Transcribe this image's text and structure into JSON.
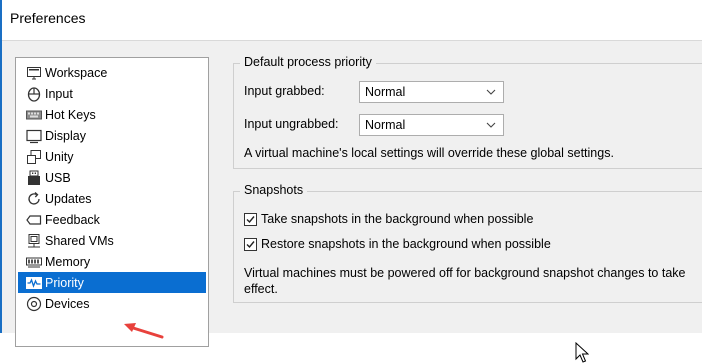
{
  "window": {
    "title": "Preferences"
  },
  "sidebar": {
    "items": [
      {
        "label": "Workspace",
        "icon": "workspace-icon"
      },
      {
        "label": "Input",
        "icon": "input-icon"
      },
      {
        "label": "Hot Keys",
        "icon": "keyboard-icon"
      },
      {
        "label": "Display",
        "icon": "display-icon"
      },
      {
        "label": "Unity",
        "icon": "unity-icon"
      },
      {
        "label": "USB",
        "icon": "usb-icon"
      },
      {
        "label": "Updates",
        "icon": "updates-icon"
      },
      {
        "label": "Feedback",
        "icon": "feedback-icon"
      },
      {
        "label": "Shared VMs",
        "icon": "shared-vms-icon"
      },
      {
        "label": "Memory",
        "icon": "memory-icon"
      },
      {
        "label": "Priority",
        "icon": "priority-icon",
        "selected": true
      },
      {
        "label": "Devices",
        "icon": "devices-icon"
      }
    ]
  },
  "priority_group": {
    "title": "Default process priority",
    "input_grabbed_label": "Input grabbed:",
    "input_grabbed_value": "Normal",
    "input_ungrabbed_label": "Input ungrabbed:",
    "input_ungrabbed_value": "Normal",
    "note": "A virtual machine's local settings will override these global settings."
  },
  "snapshots_group": {
    "title": "Snapshots",
    "take_label": "Take snapshots in the background when possible",
    "take_checked": true,
    "restore_label": "Restore snapshots in the background when possible",
    "restore_checked": true,
    "note": "Virtual machines must be powered off for background snapshot changes to take effect."
  },
  "colors": {
    "selection": "#0a6ed1",
    "annotation_arrow": "#e8413c"
  }
}
